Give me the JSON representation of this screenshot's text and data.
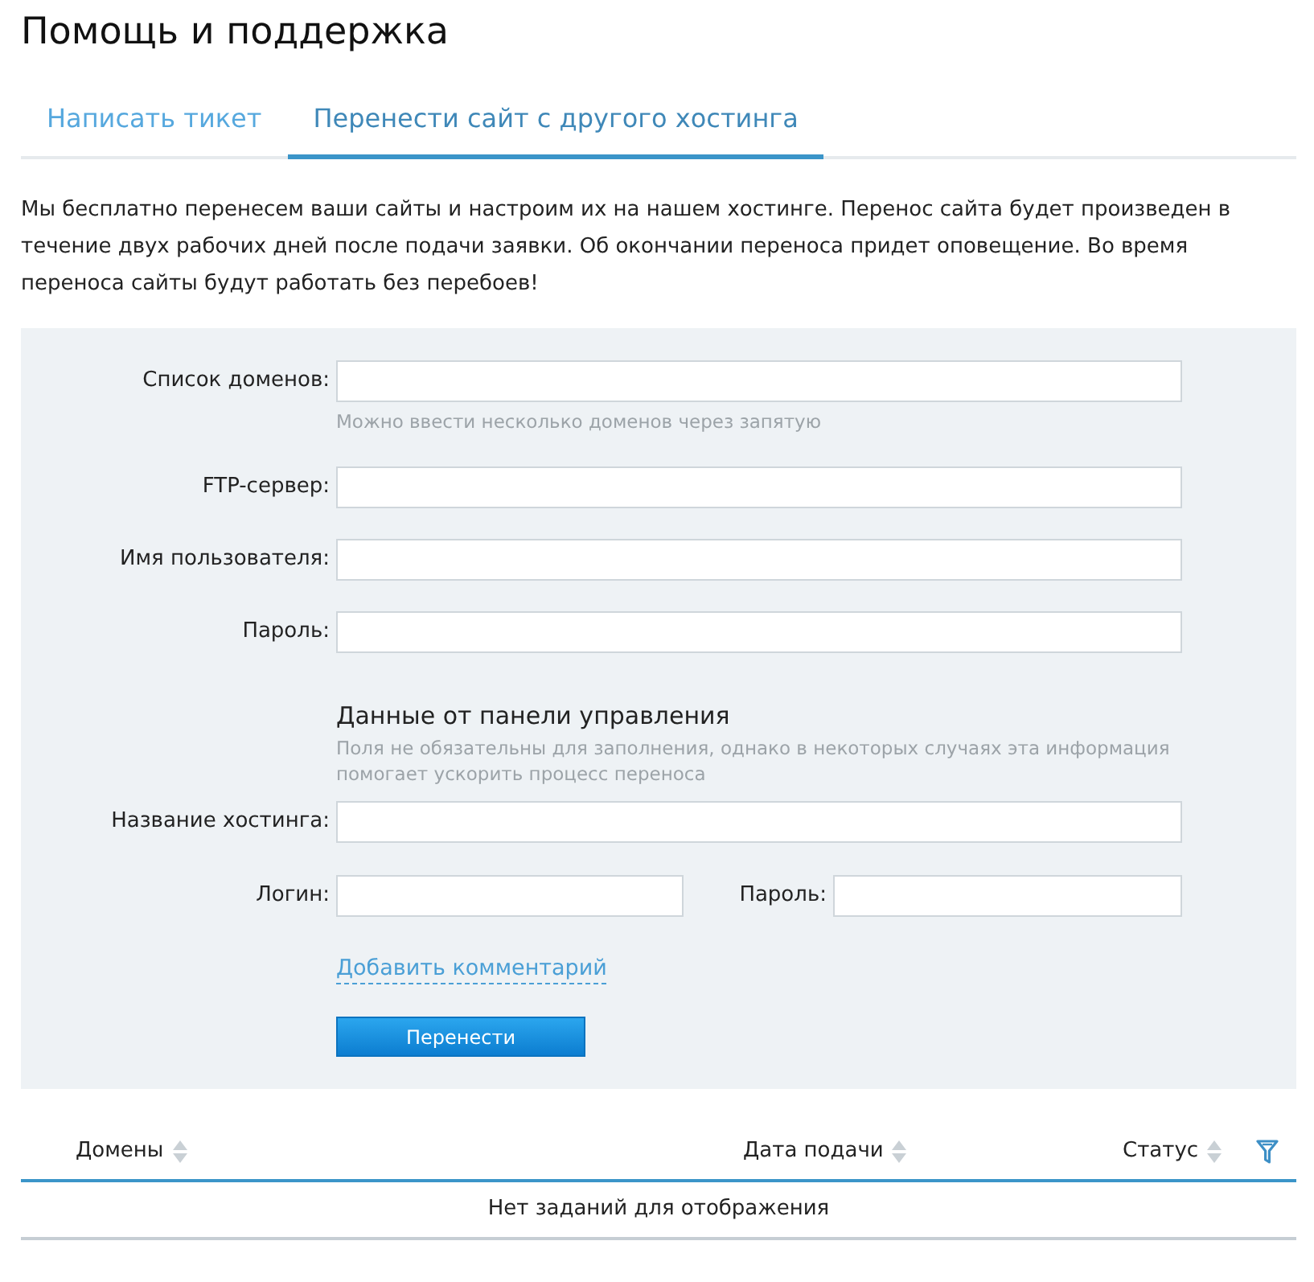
{
  "page": {
    "title": "Помощь и поддержка"
  },
  "tabs": [
    {
      "label": "Написать тикет",
      "selected": false
    },
    {
      "label": "Перенести сайт с другого хостинга",
      "selected": true
    }
  ],
  "intro": "Мы бесплатно перенесем ваши сайты и настроим их на нашем хостинге. Перенос сайта будет произведен в течение двух рабочих дней после подачи заявки. Об окончании переноса придет оповещение. Во время переноса сайты будут работать без перебоев!",
  "form": {
    "fields": [
      {
        "label": "Список доменов:",
        "hint": "Можно ввести несколько доменов через запятую"
      },
      {
        "label": "FTP-сервер:"
      },
      {
        "label": "Имя пользователя:"
      },
      {
        "label": "Пароль:"
      }
    ],
    "panel_section": {
      "heading": "Данные от панели управления",
      "hint": "Поля не обязательны для заполнения, однако в некоторых случаях эта информация помогает ускорить процесс переноса"
    },
    "panel_rows": [
      [
        {
          "label": "Название хостинга:"
        }
      ],
      [
        {
          "label": "Логин:"
        },
        {
          "label": "Пароль:"
        }
      ]
    ],
    "comment_link": "Добавить комментарий",
    "submit_button": "Перенести"
  },
  "table": {
    "columns": [
      {
        "label": "Домены",
        "sortable": true
      },
      {
        "label": "Дата подачи",
        "sortable": true
      },
      {
        "label": "Статус",
        "sortable": true
      }
    ],
    "empty_message": "Нет заданий для отображения"
  }
}
